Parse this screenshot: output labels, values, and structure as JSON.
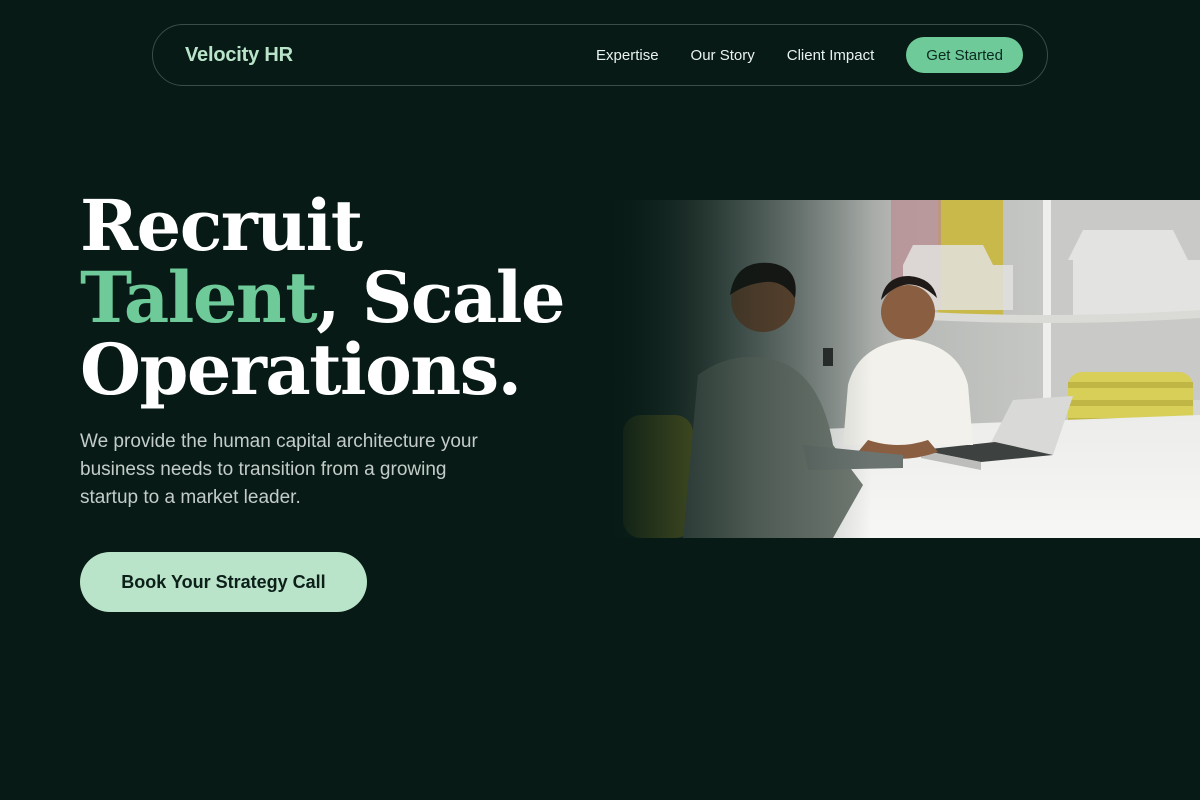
{
  "nav": {
    "brand": "Velocity HR",
    "links": [
      "Expertise",
      "Our Story",
      "Client Impact"
    ],
    "cta": "Get Started"
  },
  "hero": {
    "headline_line1": "Recruit",
    "headline_accent": "Talent",
    "headline_line2_rest": ", Scale",
    "headline_line3": "Operations.",
    "subtext": "We provide the human capital architecture your business needs to transition from a growing startup to a market leader.",
    "cta": "Book Your Strategy Call"
  },
  "colors": {
    "background": "#071a15",
    "accent": "#6ecb99",
    "cta_light": "#b9e4c9"
  }
}
